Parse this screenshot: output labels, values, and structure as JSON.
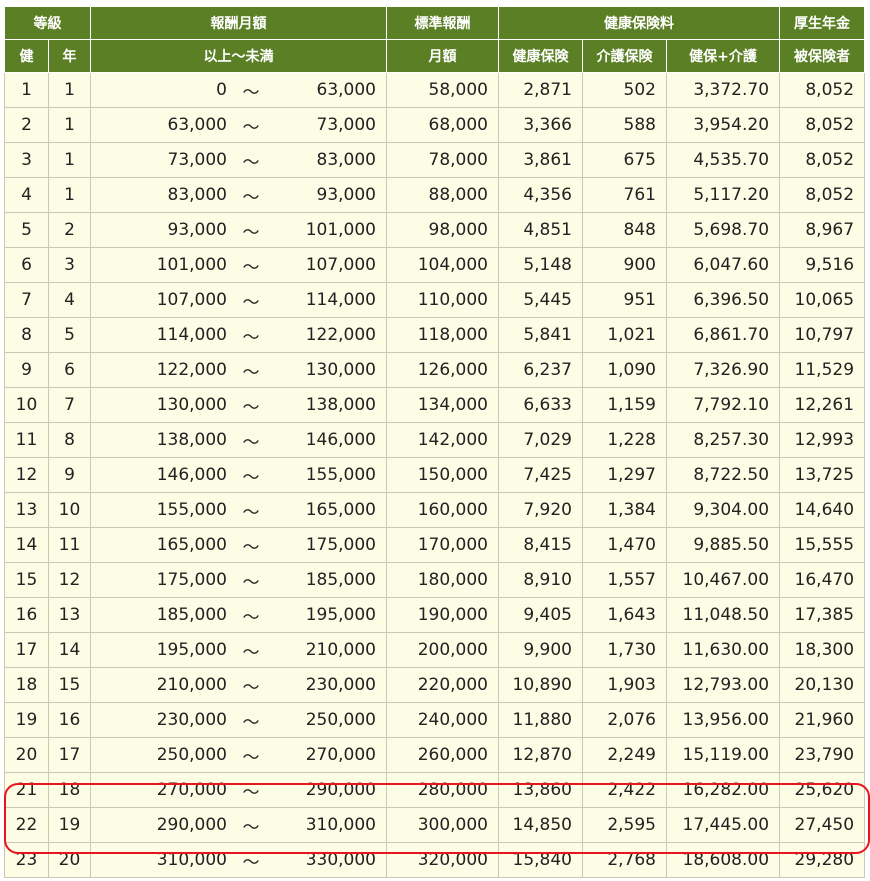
{
  "header": {
    "grade": "等級",
    "monthly_range": "報酬月額",
    "standard": "標準報酬",
    "health_premium": "健康保険料",
    "pension": "厚生年金",
    "col_ken": "健",
    "col_nen": "年",
    "col_range": "以上～未満",
    "col_monthly": "月額",
    "col_health": "健康保険",
    "col_care": "介護保険",
    "col_health_care": "健保+介護",
    "col_insured": "被保険者"
  },
  "tilde": "～",
  "rows": [
    [
      "1",
      "1",
      "0",
      "63,000",
      "58,000",
      "2,871",
      "502",
      "3,372.70",
      "8,052"
    ],
    [
      "2",
      "1",
      "63,000",
      "73,000",
      "68,000",
      "3,366",
      "588",
      "3,954.20",
      "8,052"
    ],
    [
      "3",
      "1",
      "73,000",
      "83,000",
      "78,000",
      "3,861",
      "675",
      "4,535.70",
      "8,052"
    ],
    [
      "4",
      "1",
      "83,000",
      "93,000",
      "88,000",
      "4,356",
      "761",
      "5,117.20",
      "8,052"
    ],
    [
      "5",
      "2",
      "93,000",
      "101,000",
      "98,000",
      "4,851",
      "848",
      "5,698.70",
      "8,967"
    ],
    [
      "6",
      "3",
      "101,000",
      "107,000",
      "104,000",
      "5,148",
      "900",
      "6,047.60",
      "9,516"
    ],
    [
      "7",
      "4",
      "107,000",
      "114,000",
      "110,000",
      "5,445",
      "951",
      "6,396.50",
      "10,065"
    ],
    [
      "8",
      "5",
      "114,000",
      "122,000",
      "118,000",
      "5,841",
      "1,021",
      "6,861.70",
      "10,797"
    ],
    [
      "9",
      "6",
      "122,000",
      "130,000",
      "126,000",
      "6,237",
      "1,090",
      "7,326.90",
      "11,529"
    ],
    [
      "10",
      "7",
      "130,000",
      "138,000",
      "134,000",
      "6,633",
      "1,159",
      "7,792.10",
      "12,261"
    ],
    [
      "11",
      "8",
      "138,000",
      "146,000",
      "142,000",
      "7,029",
      "1,228",
      "8,257.30",
      "12,993"
    ],
    [
      "12",
      "9",
      "146,000",
      "155,000",
      "150,000",
      "7,425",
      "1,297",
      "8,722.50",
      "13,725"
    ],
    [
      "13",
      "10",
      "155,000",
      "165,000",
      "160,000",
      "7,920",
      "1,384",
      "9,304.00",
      "14,640"
    ],
    [
      "14",
      "11",
      "165,000",
      "175,000",
      "170,000",
      "8,415",
      "1,470",
      "9,885.50",
      "15,555"
    ],
    [
      "15",
      "12",
      "175,000",
      "185,000",
      "180,000",
      "8,910",
      "1,557",
      "10,467.00",
      "16,470"
    ],
    [
      "16",
      "13",
      "185,000",
      "195,000",
      "190,000",
      "9,405",
      "1,643",
      "11,048.50",
      "17,385"
    ],
    [
      "17",
      "14",
      "195,000",
      "210,000",
      "200,000",
      "9,900",
      "1,730",
      "11,630.00",
      "18,300"
    ],
    [
      "18",
      "15",
      "210,000",
      "230,000",
      "220,000",
      "10,890",
      "1,903",
      "12,793.00",
      "20,130"
    ],
    [
      "19",
      "16",
      "230,000",
      "250,000",
      "240,000",
      "11,880",
      "2,076",
      "13,956.00",
      "21,960"
    ],
    [
      "20",
      "17",
      "250,000",
      "270,000",
      "260,000",
      "12,870",
      "2,249",
      "15,119.00",
      "23,790"
    ],
    [
      "21",
      "18",
      "270,000",
      "290,000",
      "280,000",
      "13,860",
      "2,422",
      "16,282.00",
      "25,620"
    ],
    [
      "22",
      "19",
      "290,000",
      "310,000",
      "300,000",
      "14,850",
      "2,595",
      "17,445.00",
      "27,450"
    ],
    [
      "23",
      "20",
      "310,000",
      "330,000",
      "320,000",
      "15,840",
      "2,768",
      "18,608.00",
      "29,280"
    ]
  ],
  "highlight_color": "#e8141e"
}
